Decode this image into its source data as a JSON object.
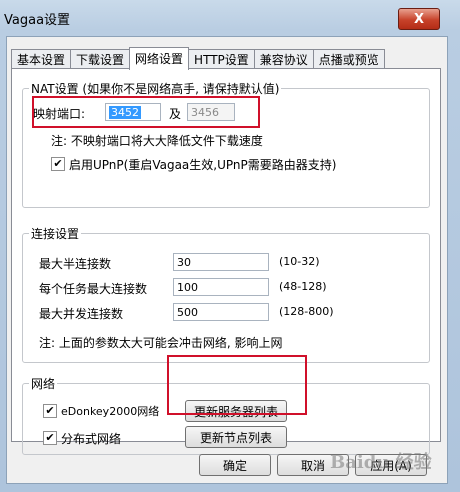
{
  "window": {
    "title": "Vagaa设置",
    "close_label": "X"
  },
  "tabs": [
    {
      "label": "基本设置"
    },
    {
      "label": "下载设置"
    },
    {
      "label": "网络设置"
    },
    {
      "label": "HTTP设置"
    },
    {
      "label": "兼容协议"
    },
    {
      "label": "点播或预览"
    }
  ],
  "active_tab": "网络设置",
  "nat": {
    "title": "NAT设置 (如果你不是网络高手, 请保持默认值)",
    "port_label": "映射端口:",
    "port_value": "3452",
    "and_label": "及",
    "port2_value": "3456",
    "note": "注: 不映射端口将大大降低文件下载速度",
    "upnp_label": "启用UPnP(重启Vagaa生效,UPnP需要路由器支持)",
    "upnp_checked": true
  },
  "conn": {
    "title": "连接设置",
    "rows": [
      {
        "label": "最大半连接数",
        "value": "30",
        "range": "(10-32)"
      },
      {
        "label": "每个任务最大连接数",
        "value": "100",
        "range": "(48-128)"
      },
      {
        "label": "最大并发连接数",
        "value": "500",
        "range": "(128-800)"
      }
    ],
    "note": "注: 上面的参数太大可能会冲击网络, 影响上网"
  },
  "network": {
    "title": "网络",
    "edonkey_label": "eDonkey2000网络",
    "edonkey_checked": true,
    "dist_label": "分布式网络",
    "dist_checked": true,
    "update_servers_label": "更新服务器列表",
    "update_nodes_label": "更新节点列表"
  },
  "footer": {
    "ok_label": "确定",
    "cancel_label": "取消",
    "apply_label": "应用(A)"
  },
  "check_glyph": "✔",
  "watermark": "Baidu 经验"
}
